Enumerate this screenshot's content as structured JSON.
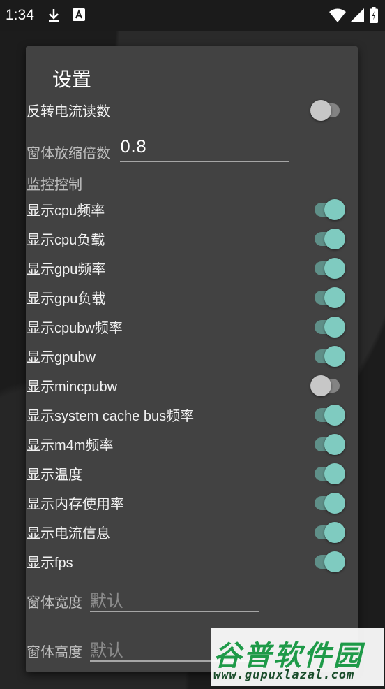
{
  "status_bar": {
    "time": "1:34",
    "icons": [
      "download-icon",
      "app-notification-icon",
      "wifi-icon",
      "signal-icon",
      "battery-icon"
    ]
  },
  "dialog": {
    "title": "设置",
    "reverse_current": {
      "label": "反转电流读数",
      "checked": false
    },
    "scale": {
      "label": "窗体放缩倍数",
      "value": "0.8"
    },
    "monitor_section": "监控控制",
    "toggles": [
      {
        "label": "显示cpu频率",
        "checked": true
      },
      {
        "label": "显示cpu负载",
        "checked": true
      },
      {
        "label": "显示gpu频率",
        "checked": true
      },
      {
        "label": "显示gpu负载",
        "checked": true
      },
      {
        "label": "显示cpubw频率",
        "checked": true
      },
      {
        "label": "显示gpubw",
        "checked": true
      },
      {
        "label": "显示mincpubw",
        "checked": false
      },
      {
        "label": "显示system cache bus频率",
        "checked": true
      },
      {
        "label": "显示m4m频率",
        "checked": true
      },
      {
        "label": "显示温度",
        "checked": true
      },
      {
        "label": "显示内存使用率",
        "checked": true
      },
      {
        "label": "显示电流信息",
        "checked": true
      },
      {
        "label": "显示fps",
        "checked": true
      }
    ],
    "width_field": {
      "label": "窗体宽度",
      "placeholder": "默认"
    },
    "height_field": {
      "label": "窗体高度",
      "placeholder": "默认"
    }
  },
  "watermark": {
    "title": "谷普软件园",
    "url": "www.gupuxlazal.com"
  },
  "colors": {
    "accent_thumb": "#7fcbc0",
    "accent_track": "#5f8f88",
    "dialog_bg": "#424242"
  }
}
